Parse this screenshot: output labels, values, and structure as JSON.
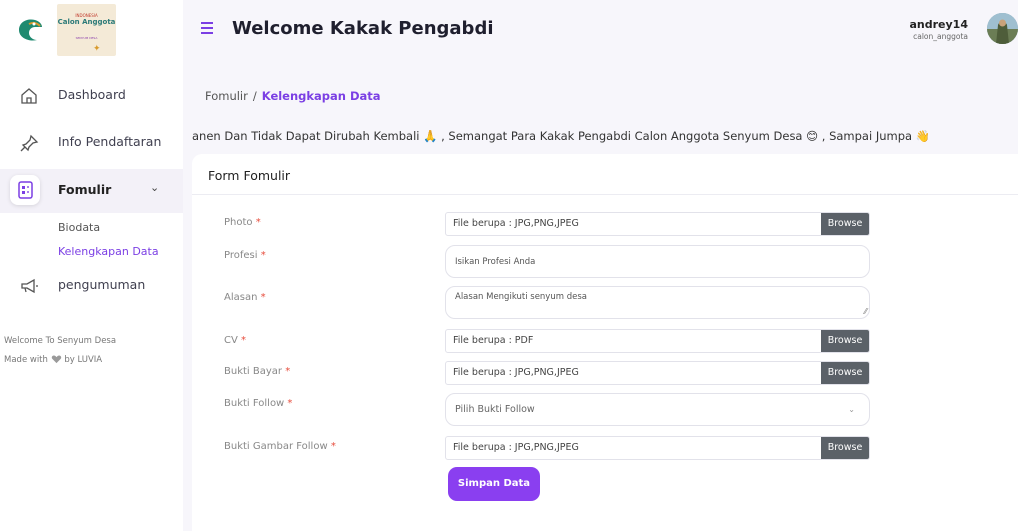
{
  "brand": {
    "org_small": "INDONESIA",
    "logo_title": "Calon Anggota",
    "org_bottom": "SENYUM DESA"
  },
  "sidebar": {
    "items": [
      {
        "label": "Dashboard",
        "icon": "home-icon"
      },
      {
        "label": "Info Pendaftaran",
        "icon": "pin-icon"
      },
      {
        "label": "Fomulir",
        "icon": "form-icon"
      },
      {
        "label": "pengumuman",
        "icon": "megaphone-icon"
      }
    ],
    "sub_items": [
      {
        "label": "Biodata"
      },
      {
        "label": "Kelengkapan Data"
      }
    ],
    "footer_line1": "Welcome To Senyum Desa",
    "footer_made": "Made with",
    "footer_by": "by LUVIA"
  },
  "header": {
    "title": "Welcome Kakak Pengabdi",
    "username": "andrey14",
    "role": "calon_anggota"
  },
  "breadcrumb": {
    "parent": "Fomulir",
    "separator": "/",
    "current": "Kelengkapan Data"
  },
  "marquee": "anen Dan Tidak Dapat Dirubah Kembali 🙏 , Semangat Para Kakak Pengabdi Calon Anggota Senyum Desa 😊 , Sampai Jumpa 👋",
  "form": {
    "title": "Form Fomulir",
    "required_mark": "*",
    "browse_label": "Browse",
    "fields": {
      "photo": {
        "label": "Photo",
        "placeholder": "File berupa : JPG,PNG,JPEG"
      },
      "profesi": {
        "label": "Profesi",
        "placeholder": "Isikan Profesi Anda"
      },
      "alasan": {
        "label": "Alasan",
        "placeholder": "Alasan Mengikuti senyum desa"
      },
      "cv": {
        "label": "CV",
        "placeholder": "File berupa : PDF"
      },
      "bukti_bayar": {
        "label": "Bukti Bayar",
        "placeholder": "File berupa : JPG,PNG,JPEG"
      },
      "bukti_follow": {
        "label": "Bukti Follow",
        "placeholder": "Pilih Bukti Follow"
      },
      "bukti_gambar_follow": {
        "label": "Bukti Gambar Follow",
        "placeholder": "File berupa : JPG,PNG,JPEG"
      }
    },
    "submit_label": "Simpan Data"
  },
  "colors": {
    "accent": "#8a3ff0",
    "link": "#7b3fe4",
    "browse": "#5b6168",
    "required": "#e74c3c"
  }
}
